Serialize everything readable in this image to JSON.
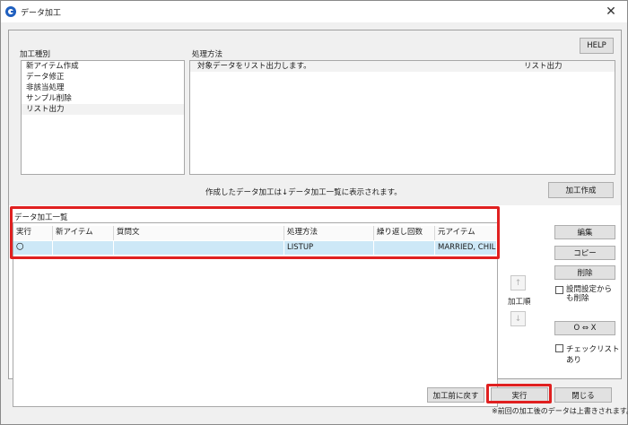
{
  "window": {
    "title": "データ加工",
    "close_glyph": "✕"
  },
  "help_button": "HELP",
  "processing_type": {
    "label": "加工種別",
    "items": [
      "新アイテム作成",
      "データ修正",
      "非該当処理",
      "サンプル削除",
      "リスト出力"
    ],
    "selected_index": 4
  },
  "processing_method": {
    "label": "処理方法",
    "row": {
      "description": "対象データをリスト出力します。",
      "type": "リスト出力"
    }
  },
  "note_text": "作成したデータ加工は↓データ加工一覧に表示されます。",
  "create_button": "加工作成",
  "process_list": {
    "label": "データ加工一覧",
    "columns": [
      "実行",
      "新アイテム",
      "質問文",
      "処理方法",
      "繰り返し回数",
      "元アイテム"
    ],
    "rows": [
      {
        "exec": "〇",
        "new_item": "",
        "question": "",
        "method": "LISTUP",
        "repeat": "",
        "source": "MARRIED, CHILD"
      }
    ]
  },
  "side_buttons": {
    "edit": "編集",
    "copy": "コピー",
    "delete": "削除",
    "delete_from_question": "設問設定からも削除",
    "order_label": "加工順",
    "up_arrow": "↑",
    "down_arrow": "↓",
    "toggle": "O ⇔ X",
    "check_list": "チェックリストあり"
  },
  "bottom": {
    "undo_button": "加工前に戻す",
    "run_button": "実行",
    "close_button": "閉じる",
    "warning": "※前回の加工後のデータは上書きされます。"
  },
  "colors": {
    "selection": "#cde8f7",
    "highlight_frame": "#e02020",
    "window_bg": "#f0f0f0"
  }
}
